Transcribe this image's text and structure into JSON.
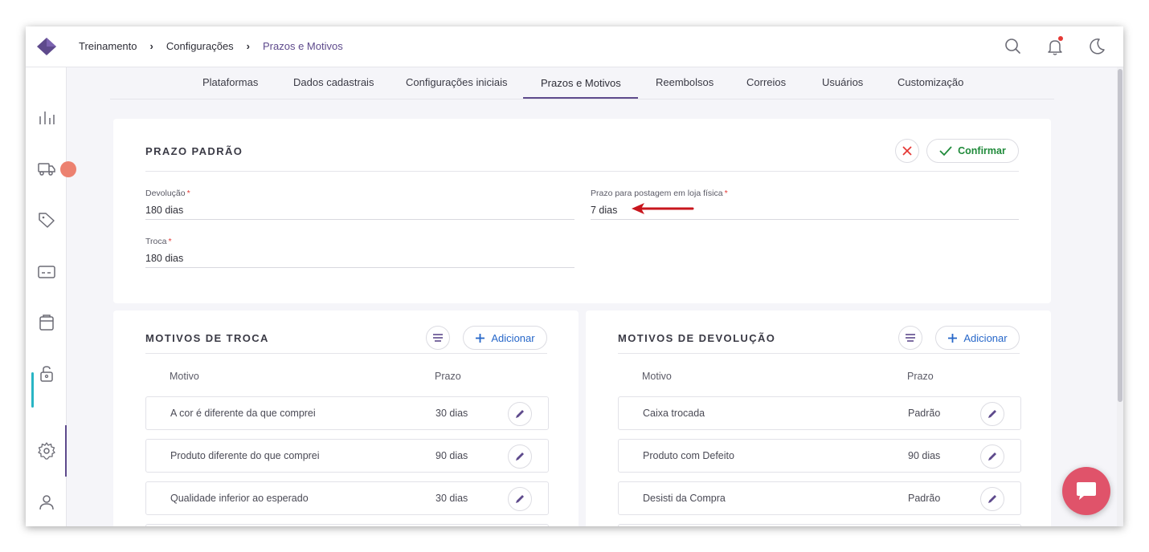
{
  "breadcrumb": [
    "Treinamento",
    "Configurações",
    "Prazos e Motivos"
  ],
  "header_icons": [
    "search-icon",
    "bell-icon",
    "moon-icon"
  ],
  "sidebar_icons": [
    "chart-icon",
    "truck-icon",
    "tag-icon",
    "card-icon",
    "box-icon",
    "lock-icon",
    "gear-icon",
    "user-icon"
  ],
  "tabs": [
    {
      "label": "Plataformas"
    },
    {
      "label": "Dados cadastrais"
    },
    {
      "label": "Configurações iniciais"
    },
    {
      "label": "Prazos e Motivos",
      "active": true
    },
    {
      "label": "Reembolsos"
    },
    {
      "label": "Correios"
    },
    {
      "label": "Usuários"
    },
    {
      "label": "Customização"
    }
  ],
  "prazo": {
    "title": "PRAZO PADRÃO",
    "confirm_label": "Confirmar",
    "devolucao_label": "Devolução",
    "devolucao_value": "180 dias",
    "loja_label": "Prazo para postagem em loja física",
    "loja_value": "7 dias",
    "troca_label": "Troca",
    "troca_value": "180 dias",
    "required_mark": "*"
  },
  "troca": {
    "title": "MOTIVOS DE TROCA",
    "add_label": "Adicionar",
    "col_motivo": "Motivo",
    "col_prazo": "Prazo",
    "rows": [
      {
        "motivo": "A cor é diferente da que comprei",
        "prazo": "30 dias"
      },
      {
        "motivo": "Produto diferente do que comprei",
        "prazo": "90 dias"
      },
      {
        "motivo": "Qualidade inferior ao esperado",
        "prazo": "30 dias"
      }
    ]
  },
  "devolucao": {
    "title": "MOTIVOS DE DEVOLUÇÃO",
    "add_label": "Adicionar",
    "col_motivo": "Motivo",
    "col_prazo": "Prazo",
    "rows": [
      {
        "motivo": "Caixa trocada",
        "prazo": "Padrão"
      },
      {
        "motivo": "Produto com Defeito",
        "prazo": "90 dias"
      },
      {
        "motivo": "Desisti da Compra",
        "prazo": "Padrão"
      }
    ]
  },
  "colors": {
    "accent": "#5e4a8c",
    "confirm": "#1f8a3a",
    "add": "#2767c9",
    "chat": "#e0536a",
    "annotation_arrow": "#c8161d"
  }
}
